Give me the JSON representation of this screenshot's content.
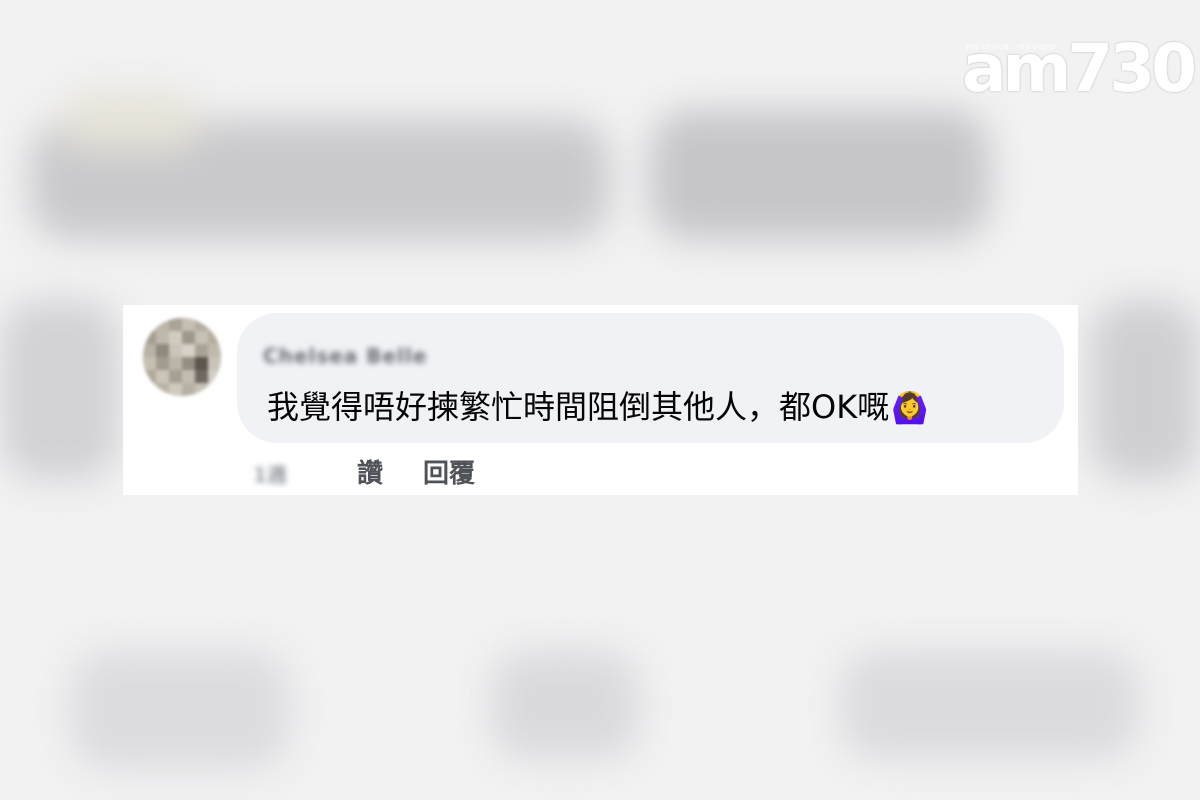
{
  "watermark": {
    "brand": "am730",
    "tagline": "my choice . my paper"
  },
  "comment": {
    "author": "Chelsea Belle",
    "text": "我覺得唔好揀繁忙時間阻倒其他人，都OK嘅",
    "emoji": "🙆‍♀️",
    "timestamp": "1週",
    "like_label": "讚",
    "reply_label": "回覆"
  },
  "colors": {
    "bubble": "#f0f2f5",
    "text": "#050505",
    "action": "#4f5257"
  }
}
